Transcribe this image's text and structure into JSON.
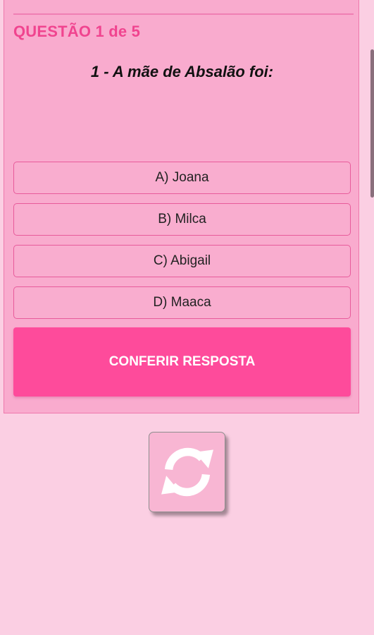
{
  "quiz": {
    "counter": "QUESTÃO 1 de 5",
    "question": "1 - A mãe de Absalão foi:",
    "options": [
      {
        "label": "A) Joana"
      },
      {
        "label": "B) Milca"
      },
      {
        "label": "C) Abigail"
      },
      {
        "label": "D) Maaca"
      }
    ],
    "check_label": "CONFERIR RESPOSTA"
  },
  "icons": {
    "refresh": "refresh-icon"
  },
  "colors": {
    "background": "#fbcfe3",
    "card": "#f9abce",
    "accent": "#fe4b9b",
    "counter_text": "#f0448f"
  }
}
